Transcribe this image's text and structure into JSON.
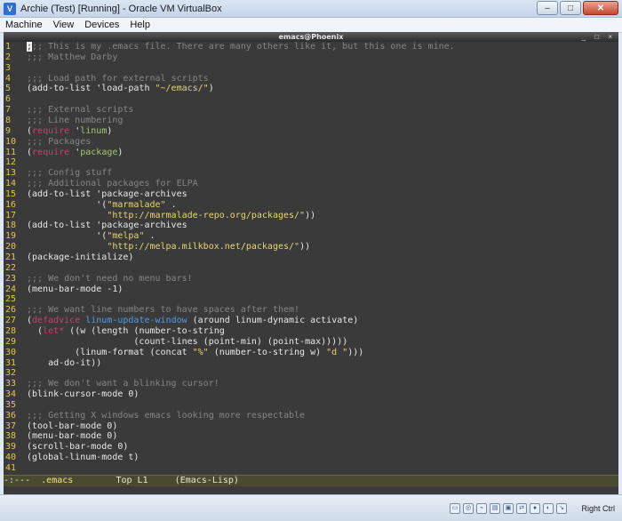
{
  "window": {
    "title": "Archie (Test) [Running] - Oracle VM VirtualBox",
    "minimize": "–",
    "maximize": "□",
    "close": "✕"
  },
  "menubar": [
    "Machine",
    "View",
    "Devices",
    "Help"
  ],
  "emacs": {
    "frame_title": "emacs@Phoenix",
    "frame_controls": "_ □ ×",
    "lines": [
      {
        "n": "1",
        "html": "<span class=\"cursor\">;</span><span class=\"c\">;; This is my .emacs file. There are many others like it, but this one is mine.</span>"
      },
      {
        "n": "2",
        "html": "<span class=\"c\">;;; Matthew Darby</span>"
      },
      {
        "n": "3",
        "html": ""
      },
      {
        "n": "4",
        "html": "<span class=\"c\">;;; Load path for external scripts</span>"
      },
      {
        "n": "5",
        "html": "(add-to-list 'load-path <span class=\"s\">\"~/emacs/\"</span>)"
      },
      {
        "n": "6",
        "html": ""
      },
      {
        "n": "7",
        "html": "<span class=\"c\">;;; External scripts</span>"
      },
      {
        "n": "8",
        "html": "<span class=\"c\">;;; Line numbering</span>"
      },
      {
        "n": "9",
        "html": "(<span class=\"kw\">require</span> '<span class=\"q\">linum</span>)"
      },
      {
        "n": "10",
        "html": "<span class=\"c\">;;; Packages</span>"
      },
      {
        "n": "11",
        "html": "(<span class=\"kw\">require</span> '<span class=\"q\">package</span>)"
      },
      {
        "n": "12",
        "html": ""
      },
      {
        "n": "13",
        "html": "<span class=\"c\">;;; Config stuff</span>"
      },
      {
        "n": "14",
        "html": "<span class=\"c\">;;; Additional packages for ELPA</span>"
      },
      {
        "n": "15",
        "html": "(add-to-list 'package-archives"
      },
      {
        "n": "16",
        "html": "             '(<span class=\"s\">\"marmalade\"</span> ."
      },
      {
        "n": "17",
        "html": "               <span class=\"s\">\"http://marmalade-repo.org/packages/\"</span>))"
      },
      {
        "n": "18",
        "html": "(add-to-list 'package-archives"
      },
      {
        "n": "19",
        "html": "             '(<span class=\"s\">\"melpa\"</span> ."
      },
      {
        "n": "20",
        "html": "               <span class=\"s\">\"http://melpa.milkbox.net/packages/\"</span>))"
      },
      {
        "n": "21",
        "html": "(package-initialize)"
      },
      {
        "n": "22",
        "html": ""
      },
      {
        "n": "23",
        "html": "<span class=\"c\">;;; We don't need no menu bars!</span>"
      },
      {
        "n": "24",
        "html": "(menu-bar-mode -1)"
      },
      {
        "n": "25",
        "html": ""
      },
      {
        "n": "26",
        "html": "<span class=\"c\">;;; We want line numbers to have spaces after them!</span>"
      },
      {
        "n": "27",
        "html": "(<span class=\"kw\">defadvice</span> <span class=\"f\">linum-update-window</span> (around linum-dynamic activate)"
      },
      {
        "n": "28",
        "html": "  (<span class=\"kw\">let*</span> ((w (length (number-to-string"
      },
      {
        "n": "29",
        "html": "                    (count-lines (point-min) (point-max)))))"
      },
      {
        "n": "30",
        "html": "         (linum-format (concat <span class=\"s\">\"%\"</span> (number-to-string w) <span class=\"s\">\"d \"</span>)))"
      },
      {
        "n": "31",
        "html": "    ad-do-it))"
      },
      {
        "n": "32",
        "html": ""
      },
      {
        "n": "33",
        "html": "<span class=\"c\">;;; We don't want a blinking cursor!</span>"
      },
      {
        "n": "34",
        "html": "(blink-cursor-mode 0)"
      },
      {
        "n": "35",
        "html": ""
      },
      {
        "n": "36",
        "html": "<span class=\"c\">;;; Getting X windows emacs looking more respectable</span>"
      },
      {
        "n": "37",
        "html": "(tool-bar-mode 0)"
      },
      {
        "n": "38",
        "html": "(menu-bar-mode 0)"
      },
      {
        "n": "39",
        "html": "(scroll-bar-mode 0)"
      },
      {
        "n": "40",
        "html": "(global-linum-mode t)"
      },
      {
        "n": "41",
        "html": ""
      }
    ],
    "modeline": {
      "status": "-:---  ",
      "buffer": ".emacs",
      "position": "        Top L1     ",
      "mode": "(Emacs-Lisp)"
    }
  },
  "statusbar": {
    "icons": [
      "disk-icon",
      "cd-icon",
      "usb-icon",
      "folder-icon",
      "display-icon",
      "network-icon",
      "record-icon",
      "mouse-icon",
      "arrow-icon"
    ],
    "hostkey": "Right Ctrl"
  }
}
